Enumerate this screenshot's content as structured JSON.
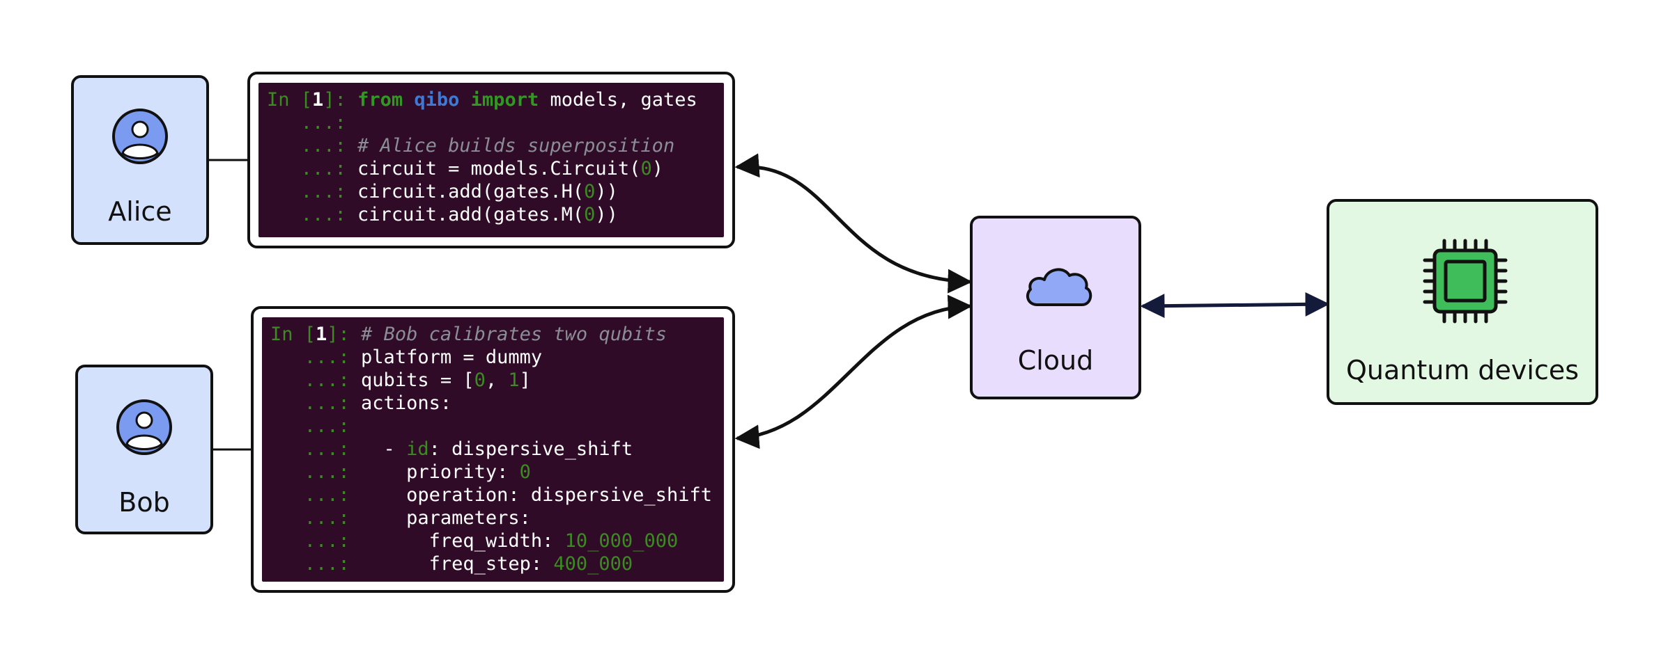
{
  "diagram": {
    "alice": {
      "label": "Alice",
      "icon": "user-avatar-icon"
    },
    "bob": {
      "label": "Bob",
      "icon": "user-avatar-icon"
    },
    "cloud": {
      "label": "Cloud",
      "icon": "cloud-icon"
    },
    "quantum": {
      "label": "Quantum devices",
      "icon": "chip-icon"
    },
    "alice_code": {
      "prompt_in": "In [",
      "prompt_num": "1",
      "prompt_end": "]: ",
      "cont": "   ...: ",
      "line1_from": "from",
      "line1_mod": "qibo",
      "line1_import": "import",
      "line1_rest": " models, gates",
      "line3_comment": "# Alice builds superposition",
      "line4_a": "circuit = models.Circuit(",
      "line4_num": "0",
      "line4_b": ")",
      "line5_a": "circuit.add(gates.H(",
      "line5_num": "0",
      "line5_b": "))",
      "line6_a": "circuit.add(gates.M(",
      "line6_num": "0",
      "line6_b": "))"
    },
    "bob_code": {
      "line1_comment": "# Bob calibrates two qubits",
      "line2": "platform = dummy",
      "line3_a": "qubits = [",
      "line3_n1": "0",
      "line3_sep": ", ",
      "line3_n2": "1",
      "line3_b": "]",
      "line4": "actions:",
      "line6_dash": "  - ",
      "line6_key": "id",
      "line6_rest": ": dispersive_shift",
      "line7_a": "    priority: ",
      "line7_num": "0",
      "line8": "    operation: dispersive_shift",
      "line9": "    parameters:",
      "line10_a": "      freq_width: ",
      "line10_num": "10_000_000",
      "line11_a": "      freq_step: ",
      "line11_num": "400_000"
    }
  },
  "colors": {
    "person_fill": "#d3e1fc",
    "cloud_fill": "#e9ddfd",
    "quantum_fill": "#e3f8e2",
    "terminal_bg": "#300b27",
    "avatar_fill": "#7b9bf0",
    "chip_fill": "#3fbd5a"
  }
}
